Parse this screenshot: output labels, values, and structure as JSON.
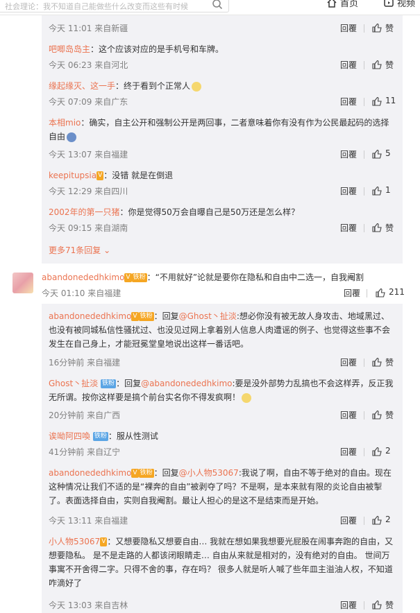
{
  "header": {
    "search_placeholder": "社会理论：我不知道自己能做些什么改变而这些有时候",
    "nav_home": "首页",
    "nav_video": "视频"
  },
  "more_replies": "更多71条回复",
  "like_label": "赞",
  "reply_label": "回覆",
  "sub1": [
    {
      "meta": "今天 11:01 来自新疆",
      "likes": "赞"
    },
    {
      "name": "吧唧岛岛主",
      "text": "：这个应该对应的是手机号和车牌。",
      "meta": "今天 06:23 来自河北",
      "likes": "赞"
    },
    {
      "name": "缘起缘灭、这一手",
      "text": "：终于看到个正常人",
      "meta": "今天 07:09 来自广东",
      "likes": "11"
    },
    {
      "name": "本相mio",
      "text": "：确实，自主公开和强制公开是两回事，二者意味着你有没有作为公民最起码的选择自由",
      "meta": "今天 13:07 来自福建",
      "likes": "5"
    },
    {
      "name": "keepitupsia",
      "text": "：没错 就是在倒退",
      "meta": "今天 12:29 来自四川",
      "likes": "1"
    },
    {
      "name": "2002年的第一只猪",
      "text": "：你是觉得50万会自曝自己是50万还是怎么样？",
      "meta": "今天 09:15 来自湖南",
      "likes": "赞"
    }
  ],
  "main": {
    "name": "abandonededhkimo",
    "badge": "铁粉",
    "text": "：“不用就好”论就是要你在隐私和自由中二选一，自我阉割",
    "meta": "今天 01:10 来自福建",
    "likes": "211"
  },
  "sub2": [
    {
      "name": "abandonededhkimo",
      "badge": "铁粉",
      "pre": "：回复",
      "at": "@Ghost丶扯淡",
      "text": ":想必你没有被无故人身攻击、地域黑过、也没有被同城私信性骚扰过、也没见过网上拿着别人信息人肉遭谣的例子、也觉得这些事不会发生在自己身上，才能冠冕堂皇地说出这样一番话吧。",
      "meta": "16分钟前 来自福建",
      "likes": "赞"
    },
    {
      "name": "Ghost丶扯淡",
      "badge": "铁粉",
      "pre": "：回复",
      "at": "@abandonededhkimo",
      "text": ":要是没外部势力乱搞也不会这样弄，反正我无所谓。按你这样要是搞个前台实名你不得发疯啊！",
      "meta": "20分钟前 来自广西",
      "likes": "赞"
    },
    {
      "name": "诶呦阿四喚",
      "badge": "铁粉",
      "text": "：服从性测试",
      "meta": "41分钟前 来自辽宁",
      "likes": "2"
    },
    {
      "name": "abandonededhkimo",
      "badge": "铁粉",
      "pre": "：回复",
      "at": "@小人物53067",
      "text": ":我说了啊，自由不等于绝对的自由。现在这种情况让我们不适的是“裸奔的自由”被剥夺了吗？不是啊，是本来就有限的炎论自由被掣了。表面选择自由，实则自我阉割。最让人担心的是这不是结束而是开始。",
      "meta": "今天 13:11 来自福建",
      "likes": "2"
    },
    {
      "name": "小人物53067",
      "text": "：又想要隐私又想要自由… 我就在想如果我想要光屁股在闹事奔跑的自由，又想要隐私。 是不是走路的人都该闭眼睛走… 自由从来就是相对的，没有绝对的自由。 世间万事寓不开舍得二字。只得不舍的事，存在吗？ 很多人就是听人喊了些年皿主溢油人权，不知道咋滴好了",
      "meta": "今天 13:03 来自吉林",
      "likes": "赞"
    }
  ]
}
